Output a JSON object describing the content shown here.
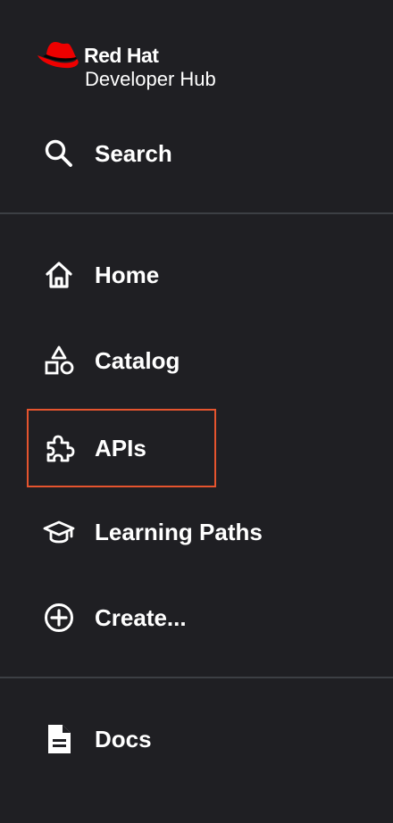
{
  "brand": {
    "line1": "Red Hat",
    "line2": "Developer Hub",
    "accent_color": "#ee0000"
  },
  "nav": {
    "search": {
      "label": "Search",
      "icon": "search-icon"
    },
    "home": {
      "label": "Home",
      "icon": "home-icon"
    },
    "catalog": {
      "label": "Catalog",
      "icon": "shapes-icon"
    },
    "apis": {
      "label": "APIs",
      "icon": "puzzle-icon",
      "highlighted": true
    },
    "learning_paths": {
      "label": "Learning Paths",
      "icon": "graduation-cap-icon"
    },
    "create": {
      "label": "Create...",
      "icon": "plus-circle-icon"
    },
    "docs": {
      "label": "Docs",
      "icon": "document-icon"
    }
  },
  "colors": {
    "background": "#1f1f23",
    "divider": "#3c3f44",
    "highlight_border": "#e5542e",
    "text": "#ffffff"
  }
}
